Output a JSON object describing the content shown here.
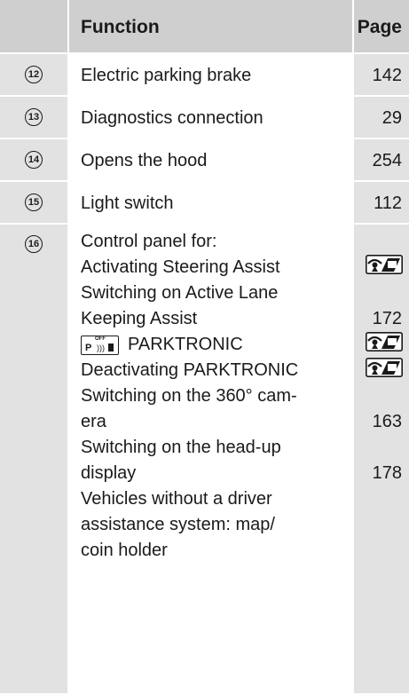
{
  "header": {
    "function": "Function",
    "page": "Page"
  },
  "rows": [
    {
      "num": "12",
      "function": "Electric parking brake",
      "page": "142"
    },
    {
      "num": "13",
      "function": "Diagnostics connection",
      "page": "29"
    },
    {
      "num": "14",
      "function": "Opens the hood",
      "page": "254"
    },
    {
      "num": "15",
      "function": "Light switch",
      "page": "112"
    }
  ],
  "control_panel": {
    "num": "16",
    "lines": [
      "Control panel for:",
      "Activating Steering Assist",
      "Switching on Active Lane",
      "Keeping Assist",
      "PARKTRONIC",
      "Deactivating PARKTRONIC",
      "Switching on the 360° cam-",
      "era",
      "Switching on the head-up",
      "display",
      "Vehicles without a driver",
      "assistance system: map/",
      "coin holder"
    ],
    "page_refs": [
      {
        "line": 1,
        "icon": "driver-assistance-book-icon"
      },
      {
        "line": 3,
        "page": "172"
      },
      {
        "line": 4,
        "icon": "driver-assistance-book-icon"
      },
      {
        "line": 5,
        "icon": "driver-assistance-book-icon"
      },
      {
        "line": 7,
        "page": "163"
      },
      {
        "line": 9,
        "page": "178"
      }
    ],
    "parktronic_button": {
      "off": "OFF",
      "p": "P"
    }
  }
}
